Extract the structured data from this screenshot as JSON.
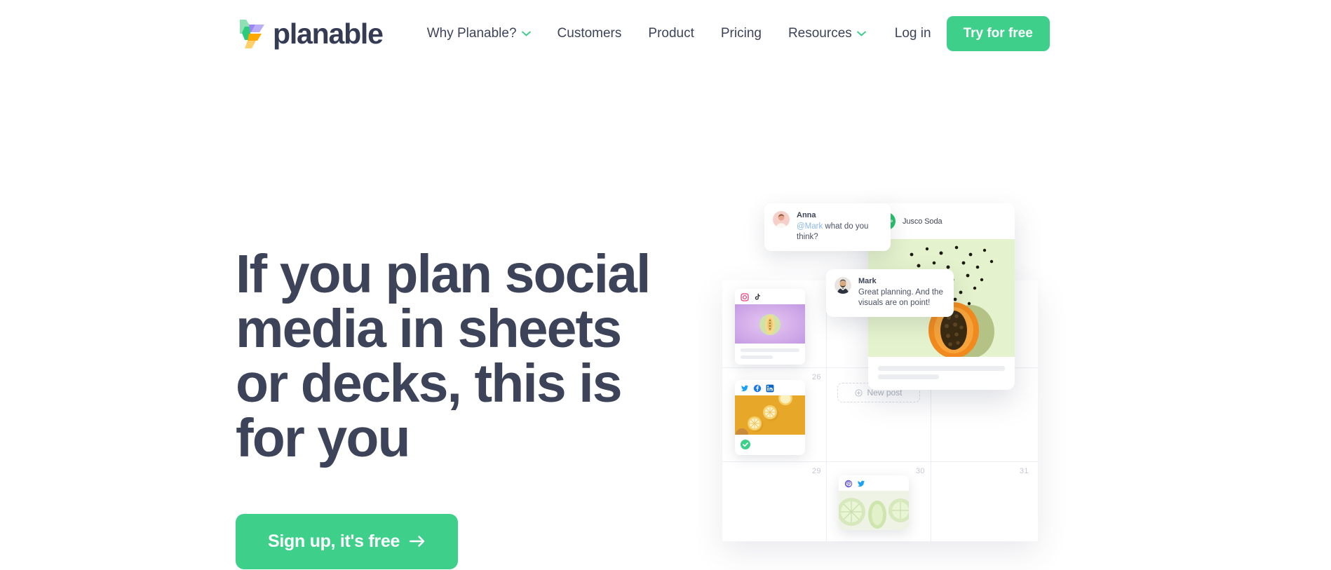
{
  "brand": {
    "name": "planable",
    "logo_icon": "planable-logo-mark",
    "colors": {
      "green_light": "#8fe0b4",
      "green_dark": "#2ecb7d",
      "purple_light": "#b9aef6",
      "purple_dark": "#9b86f2",
      "orange": "#ffa800",
      "orange_light": "#ffcf6b"
    }
  },
  "nav": {
    "items": [
      {
        "label": "Why Planable?",
        "has_dropdown": true,
        "icon": "chevron-down-icon"
      },
      {
        "label": "Customers",
        "has_dropdown": false
      },
      {
        "label": "Product",
        "has_dropdown": false
      },
      {
        "label": "Pricing",
        "has_dropdown": false
      },
      {
        "label": "Resources",
        "has_dropdown": true,
        "icon": "chevron-down-icon"
      }
    ],
    "login_label": "Log in",
    "cta_label": "Try for free",
    "cta_color": "#3ed08b",
    "chevron_color": "#3ecf8a"
  },
  "hero": {
    "title": "If you plan social media in sheets or decks, this is for you",
    "title_color": "#3d4359",
    "cta_label": "Sign up, it's free",
    "cta_arrow_icon": "arrow-right-icon",
    "cta_color": "#3ecf8a"
  },
  "art": {
    "comments": [
      {
        "author": "Anna",
        "avatar_icon": "avatar-anna",
        "mention": "@Mark",
        "text": " what do you think?"
      },
      {
        "author": "Mark",
        "avatar_icon": "avatar-mark",
        "mention": "",
        "text": "Great planning. And the visuals are on point!"
      }
    ],
    "feed_post": {
      "account_name": "Jusco Soda",
      "avatar_label": "Jusco",
      "avatar_color": "#27c06a",
      "image_alt": "papaya-halved-with-seeds",
      "image_bg": "#e4f2cd"
    },
    "calendar": {
      "dates": [
        "26",
        "29",
        "30",
        "31"
      ],
      "new_post_label": "New post",
      "new_post_icon": "plus-circle-icon",
      "posts": [
        {
          "name": "melon-post",
          "platforms": [
            "instagram-icon",
            "tiktok-icon"
          ],
          "image_alt": "melon-on-purple",
          "image_bg": "#cfa6e8",
          "approved": false
        },
        {
          "name": "lemon-post",
          "platforms": [
            "twitter-icon",
            "facebook-icon",
            "linkedin-icon"
          ],
          "image_alt": "lemon-slices-on-orange",
          "image_bg": "#e7a829",
          "approved": true,
          "approve_icon": "check-circle-icon"
        },
        {
          "name": "lime-post",
          "platforms": [
            "pinterest-icon",
            "twitter-icon"
          ],
          "image_alt": "lime-slices-on-white",
          "image_bg": "#e9f0df",
          "approved": false
        }
      ]
    }
  }
}
